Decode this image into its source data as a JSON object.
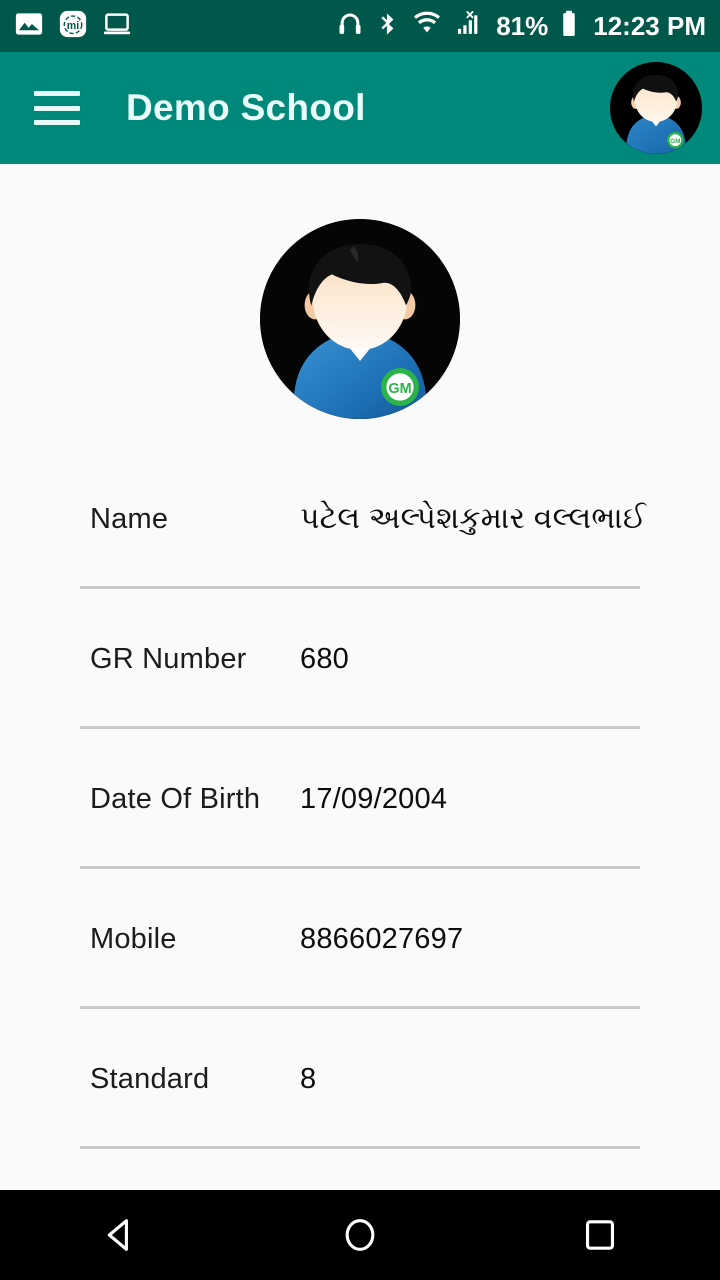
{
  "status_bar": {
    "left_icons": [
      {
        "name": "gallery-image-icon",
        "glyph": "image"
      },
      {
        "name": "mi-app-icon",
        "glyph": "mi"
      },
      {
        "name": "laptop-cast-icon",
        "glyph": "laptop"
      }
    ],
    "right_icons": [
      {
        "name": "headset-icon",
        "glyph": "headset"
      },
      {
        "name": "bluetooth-icon",
        "glyph": "bluetooth"
      },
      {
        "name": "wifi-icon",
        "glyph": "wifi"
      },
      {
        "name": "cellular-signal-no-sim-icon",
        "glyph": "signal-x"
      },
      {
        "name": "battery-icon",
        "glyph": "battery"
      }
    ],
    "battery_percent": "81%",
    "time": "12:23 PM",
    "background_color": "#00584a",
    "foreground_color": "#ffffff"
  },
  "app_bar": {
    "menu_icon": "hamburger-menu-icon",
    "title": "Demo School",
    "avatar_alt": "user-profile-avatar",
    "background_color": "#00897b",
    "title_color": "#e9fdfa"
  },
  "profile": {
    "avatar_alt": "student-profile-photo",
    "fields": [
      {
        "label": "Name",
        "value": "પટેલ અલ્પેશકુમાર વલ્લભાઈ",
        "script": "gujarati"
      },
      {
        "label": "GR Number",
        "value": "680",
        "script": "latin"
      },
      {
        "label": "Date Of Birth",
        "value": "17/09/2004",
        "script": "latin"
      },
      {
        "label": "Mobile",
        "value": "8866027697",
        "script": "latin"
      },
      {
        "label": "Standard",
        "value": "8",
        "script": "latin"
      }
    ],
    "background_color": "#fafafa",
    "divider_color": "#c9c9c9"
  },
  "nav_bar": {
    "buttons": [
      {
        "name": "back-button",
        "glyph": "triangle-left"
      },
      {
        "name": "home-button",
        "glyph": "circle"
      },
      {
        "name": "recents-button",
        "glyph": "square"
      }
    ],
    "background_color": "#000000"
  }
}
